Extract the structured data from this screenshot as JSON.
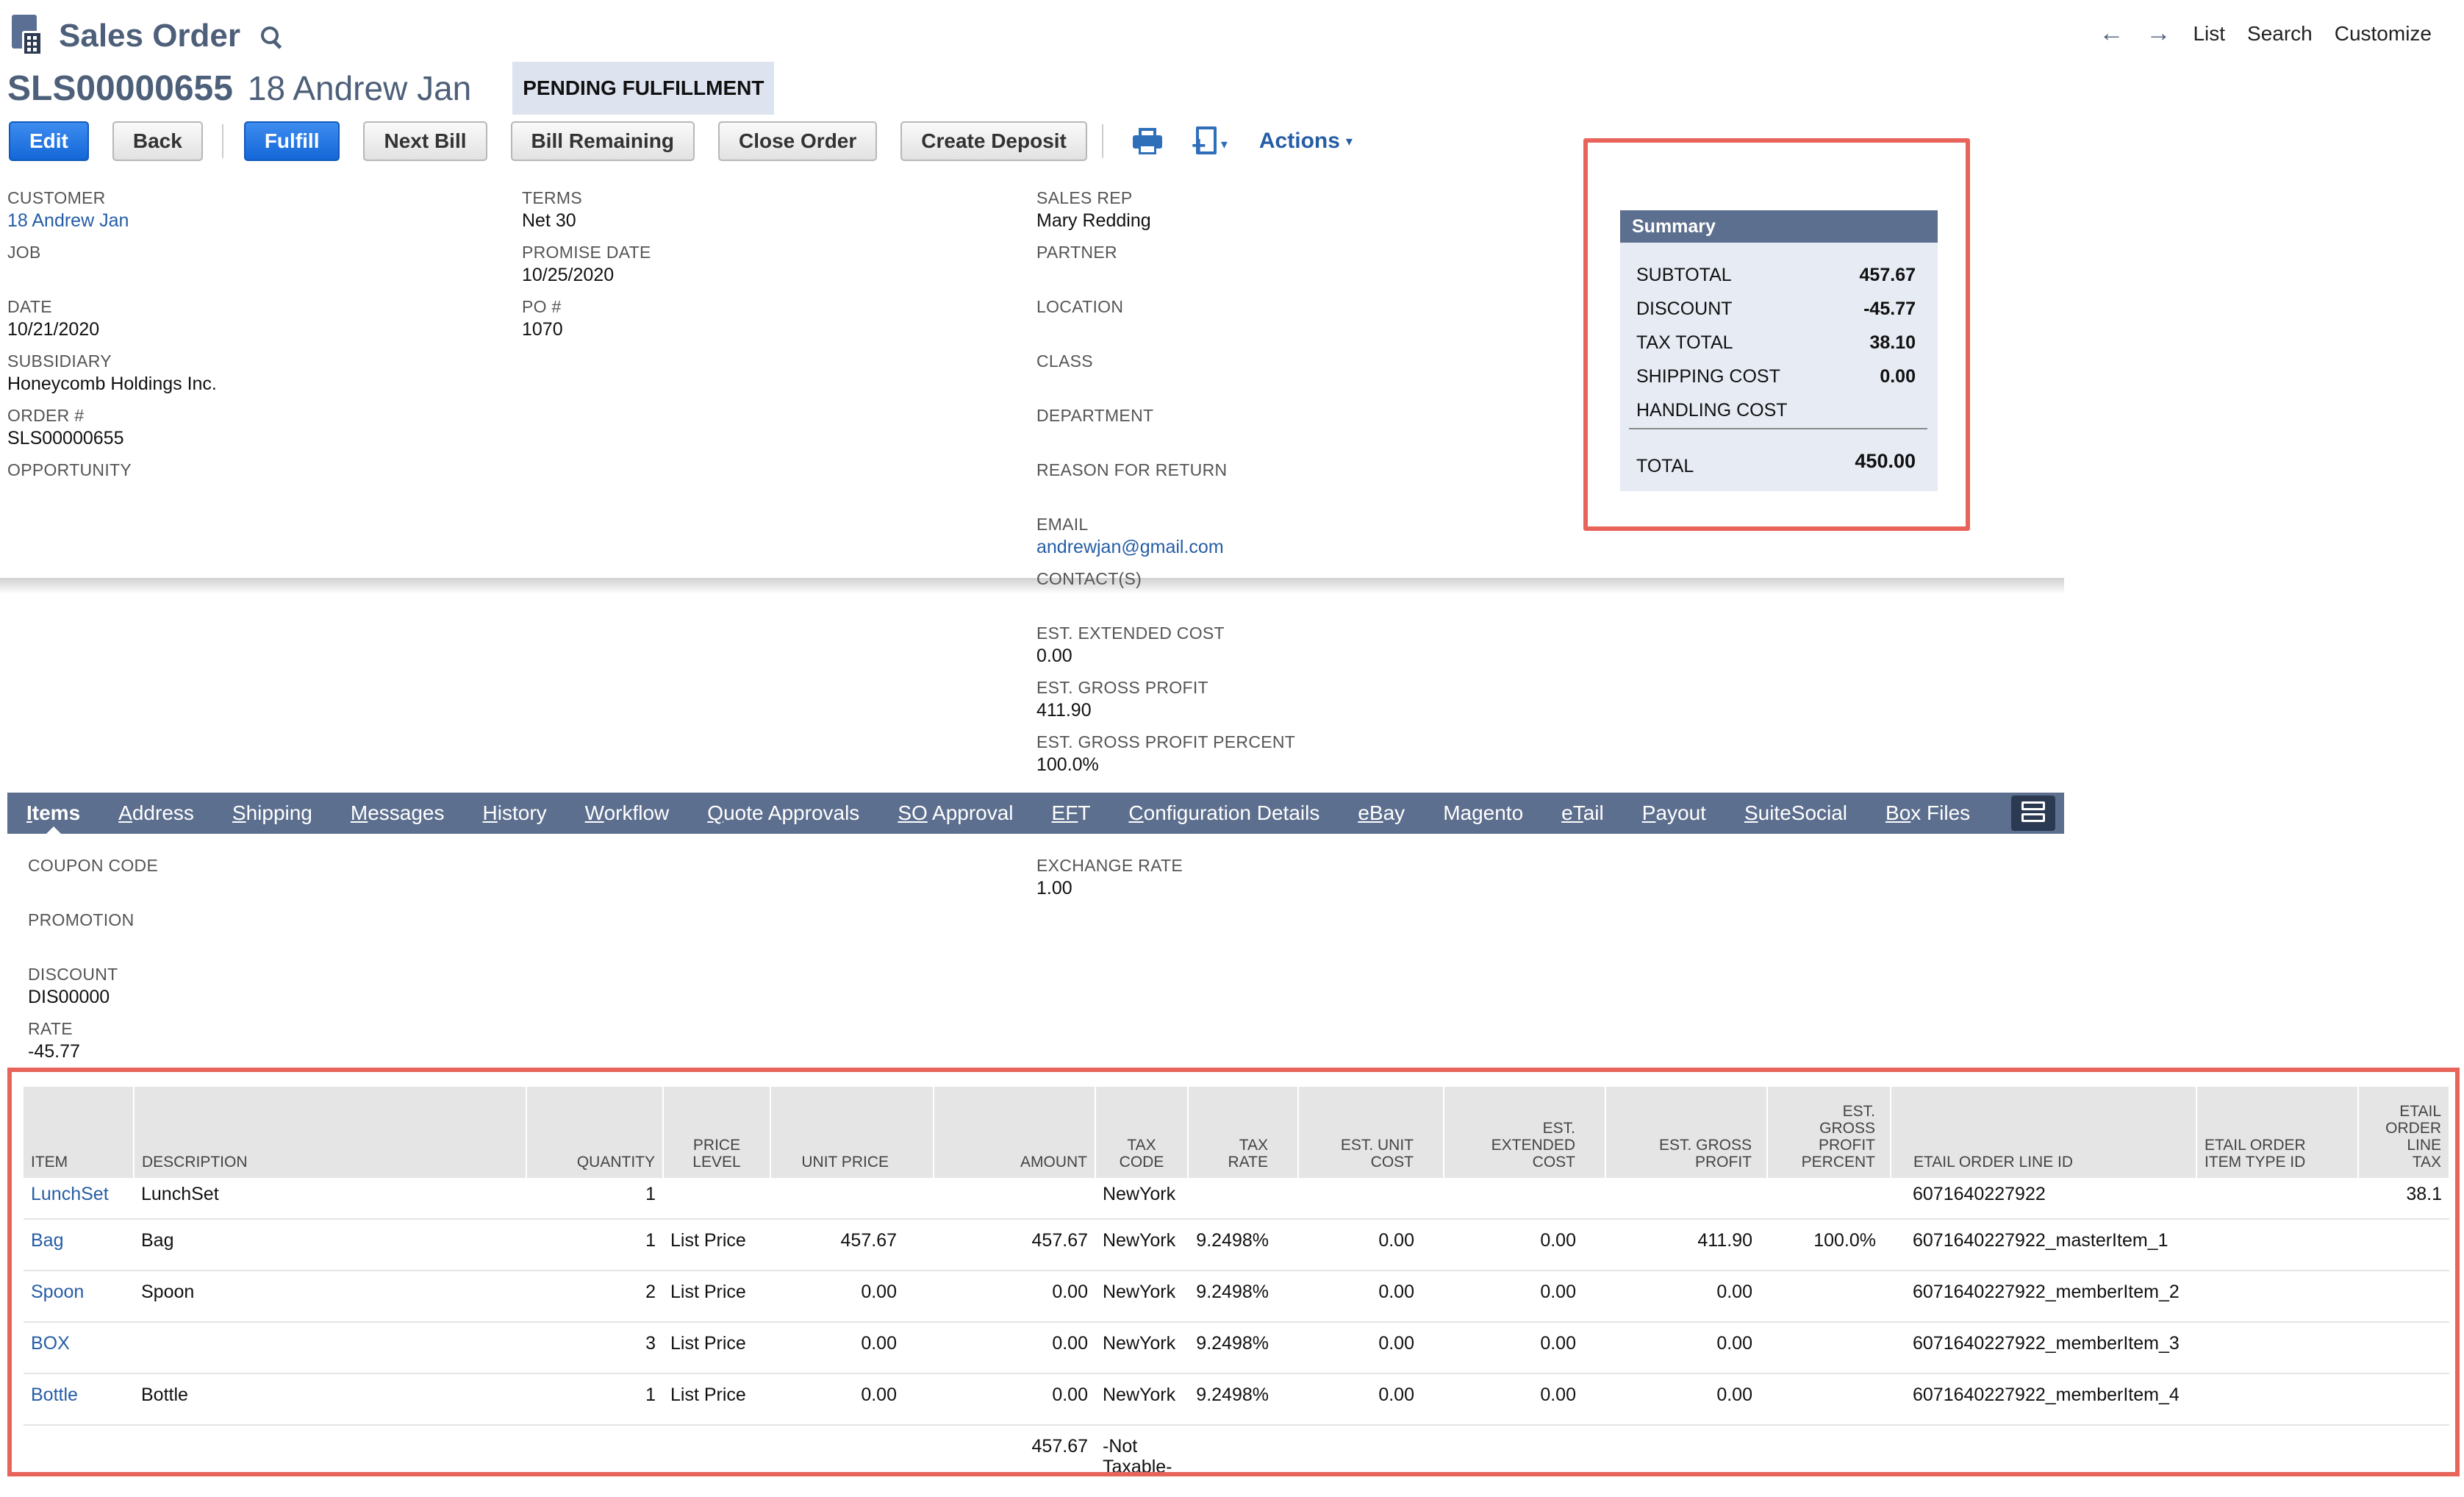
{
  "header": {
    "page_title": "Sales Order",
    "record_number": "SLS00000655",
    "record_name": "18 Andrew Jan",
    "status": "PENDING FULFILLMENT"
  },
  "topnav": {
    "back_arrow": "←",
    "forward_arrow": "→",
    "list": "List",
    "search": "Search",
    "customize": "Customize"
  },
  "buttons": {
    "edit": "Edit",
    "back": "Back",
    "fulfill": "Fulfill",
    "next_bill": "Next Bill",
    "bill_remaining": "Bill Remaining",
    "close_order": "Close Order",
    "create_deposit": "Create Deposit",
    "actions": "Actions",
    "actions_caret": "▾",
    "newdoc_plus": "+",
    "newdoc_caret": "▾"
  },
  "fields": {
    "customer": {
      "label": "CUSTOMER",
      "value": "18 Andrew Jan"
    },
    "job": {
      "label": "JOB"
    },
    "date": {
      "label": "DATE",
      "value": "10/21/2020"
    },
    "subsidiary": {
      "label": "SUBSIDIARY",
      "value": "Honeycomb Holdings Inc."
    },
    "order_num": {
      "label": "ORDER #",
      "value": "SLS00000655"
    },
    "opportunity": {
      "label": "OPPORTUNITY"
    },
    "terms": {
      "label": "TERMS",
      "value": "Net 30"
    },
    "promise_date": {
      "label": "PROMISE DATE",
      "value": "10/25/2020"
    },
    "po_num": {
      "label": "PO #",
      "value": "1070"
    },
    "sales_rep": {
      "label": "SALES REP",
      "value": "Mary Redding"
    },
    "partner": {
      "label": "PARTNER"
    },
    "location": {
      "label": "LOCATION"
    },
    "class": {
      "label": "CLASS"
    },
    "department": {
      "label": "DEPARTMENT"
    },
    "reason_for_return": {
      "label": "REASON FOR RETURN"
    },
    "email": {
      "label": "EMAIL",
      "value": "andrewjan@gmail.com"
    },
    "contacts": {
      "label": "CONTACT(S)"
    },
    "est_extended_cost": {
      "label": "EST. EXTENDED COST",
      "value": "0.00"
    },
    "est_gross_profit": {
      "label": "EST. GROSS PROFIT",
      "value": "411.90"
    },
    "est_gross_profit_percent": {
      "label": "EST. GROSS PROFIT PERCENT",
      "value": "100.0%"
    }
  },
  "summary": {
    "title": "Summary",
    "subtotal": {
      "label": "SUBTOTAL",
      "value": "457.67"
    },
    "discount": {
      "label": "DISCOUNT",
      "value": "-45.77"
    },
    "tax_total": {
      "label": "TAX TOTAL",
      "value": "38.10"
    },
    "shipping_cost": {
      "label": "SHIPPING COST",
      "value": "0.00"
    },
    "handling_cost": {
      "label": "HANDLING COST",
      "value": ""
    },
    "total": {
      "label": "TOTAL",
      "value": "450.00"
    }
  },
  "tabs": [
    {
      "u": "I",
      "rest": "tems"
    },
    {
      "u": "A",
      "rest": "ddress"
    },
    {
      "u": "S",
      "rest": "hipping"
    },
    {
      "u": "M",
      "rest": "essages"
    },
    {
      "u": "H",
      "rest": "istory"
    },
    {
      "u": "W",
      "rest": "orkflow"
    },
    {
      "u": "Q",
      "rest": "uote Approvals"
    },
    {
      "u": "SO",
      "rest": " Approval"
    },
    {
      "u": "EF",
      "rest": "T"
    },
    {
      "u": "C",
      "rest": "onfiguration Details"
    },
    {
      "u": "eB",
      "rest": "ay"
    },
    {
      "u": "",
      "rest": "Magento"
    },
    {
      "u": "eT",
      "rest": "ail"
    },
    {
      "u": "P",
      "rest": "ayout"
    },
    {
      "u": "S",
      "rest": "uiteSocial"
    },
    {
      "u": "Bo",
      "rest": "x Files"
    }
  ],
  "items_tab": {
    "coupon_code": {
      "label": "COUPON CODE"
    },
    "promotion": {
      "label": "PROMOTION"
    },
    "discount": {
      "label": "DISCOUNT",
      "value": "DIS00000"
    },
    "rate": {
      "label": "RATE",
      "value": "-45.77"
    },
    "exchange_rate": {
      "label": "EXCHANGE RATE",
      "value": "1.00"
    }
  },
  "table": {
    "columns": {
      "item": "ITEM",
      "description": "DESCRIPTION",
      "quantity": "QUANTITY",
      "price_level_1": "PRICE",
      "price_level_2": "LEVEL",
      "unit_price": "UNIT PRICE",
      "amount": "AMOUNT",
      "tax_code_1": "TAX",
      "tax_code_2": "CODE",
      "tax_rate_1": "TAX",
      "tax_rate_2": "RATE",
      "est_unit_cost_1": "EST. UNIT",
      "est_unit_cost_2": "COST",
      "est_ext_cost_1": "EST.",
      "est_ext_cost_2": "EXTENDED",
      "est_ext_cost_3": "COST",
      "est_gross_profit_1": "EST. GROSS",
      "est_gross_profit_2": "PROFIT",
      "est_gpp_1": "EST.",
      "est_gpp_2": "GROSS",
      "est_gpp_3": "PROFIT",
      "est_gpp_4": "PERCENT",
      "etail_line_id": "ETAIL ORDER LINE ID",
      "etail_item_type_1": "ETAIL ORDER",
      "etail_item_type_2": "ITEM TYPE ID",
      "etail_line_tax_1": "ETAIL",
      "etail_line_tax_2": "ORDER",
      "etail_line_tax_3": "LINE",
      "etail_line_tax_4": "TAX"
    },
    "rows": [
      {
        "item": "LunchSet",
        "description": "LunchSet",
        "quantity": "1",
        "price_level": "",
        "unit_price": "",
        "amount": "",
        "tax_code": "NewYork",
        "tax_rate": "",
        "est_unit_cost": "",
        "est_ext_cost": "",
        "est_gross_profit": "",
        "est_gpp": "",
        "etail_line_id": "6071640227922",
        "etail_item_type": "",
        "etail_line_tax": "38.1"
      },
      {
        "item": "Bag",
        "description": "Bag",
        "quantity": "1",
        "price_level": "List Price",
        "unit_price": "457.67",
        "amount": "457.67",
        "tax_code": "NewYork",
        "tax_rate": "9.2498%",
        "est_unit_cost": "0.00",
        "est_ext_cost": "0.00",
        "est_gross_profit": "411.90",
        "est_gpp": "100.0%",
        "etail_line_id": "6071640227922_masterItem_1",
        "etail_item_type": "",
        "etail_line_tax": ""
      },
      {
        "item": "Spoon",
        "description": "Spoon",
        "quantity": "2",
        "price_level": "List Price",
        "unit_price": "0.00",
        "amount": "0.00",
        "tax_code": "NewYork",
        "tax_rate": "9.2498%",
        "est_unit_cost": "0.00",
        "est_ext_cost": "0.00",
        "est_gross_profit": "0.00",
        "est_gpp": "",
        "etail_line_id": "6071640227922_memberItem_2",
        "etail_item_type": "",
        "etail_line_tax": ""
      },
      {
        "item": "BOX",
        "description": "",
        "quantity": "3",
        "price_level": "List Price",
        "unit_price": "0.00",
        "amount": "0.00",
        "tax_code": "NewYork",
        "tax_rate": "9.2498%",
        "est_unit_cost": "0.00",
        "est_ext_cost": "0.00",
        "est_gross_profit": "0.00",
        "est_gpp": "",
        "etail_line_id": "6071640227922_memberItem_3",
        "etail_item_type": "",
        "etail_line_tax": ""
      },
      {
        "item": "Bottle",
        "description": "Bottle",
        "quantity": "1",
        "price_level": "List Price",
        "unit_price": "0.00",
        "amount": "0.00",
        "tax_code": "NewYork",
        "tax_rate": "9.2498%",
        "est_unit_cost": "0.00",
        "est_ext_cost": "0.00",
        "est_gross_profit": "0.00",
        "est_gpp": "",
        "etail_line_id": "6071640227922_memberItem_4",
        "etail_item_type": "",
        "etail_line_tax": ""
      }
    ],
    "total_row": {
      "amount": "457.67",
      "tax_code_1": "-Not",
      "tax_code_2": "Taxable-"
    }
  }
}
